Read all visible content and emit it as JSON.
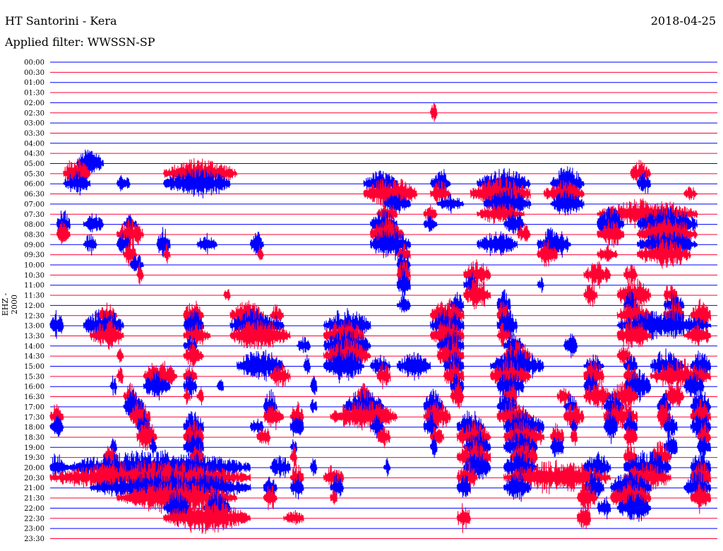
{
  "header": {
    "station": "HT Santorini - Kera",
    "date": "2018-04-25",
    "filter": "Applied filter: WWSSN-SP"
  },
  "colors": {
    "blue": "#0000ff",
    "red": "#ff0033"
  },
  "chart_data": {
    "type": "helicorder",
    "ylabel": "EHZ - 2000",
    "row_labels": [
      "00:00",
      "00:30",
      "01:00",
      "01:30",
      "02:00",
      "02:30",
      "03:00",
      "03:30",
      "04:00",
      "04:30",
      "05:00",
      "05:30",
      "06:00",
      "06:30",
      "07:00",
      "07:30",
      "08:00",
      "08:30",
      "09:00",
      "09:30",
      "10:00",
      "10:30",
      "11:00",
      "11:30",
      "12:00",
      "12:30",
      "13:00",
      "13:30",
      "14:00",
      "14:30",
      "15:00",
      "15:30",
      "16:00",
      "16:30",
      "17:00",
      "17:30",
      "18:00",
      "18:30",
      "19:00",
      "19:30",
      "20:00",
      "20:30",
      "21:00",
      "21:30",
      "22:00",
      "22:30",
      "23:00",
      "23:30"
    ],
    "row_colors": [
      "blue",
      "red",
      "blue",
      "red",
      "blue",
      "red",
      "blue",
      "red",
      "blue",
      "red",
      "blue",
      "red",
      "blue",
      "red",
      "blue",
      "red",
      "blue",
      "red",
      "blue",
      "red",
      "blue",
      "red",
      "blue",
      "red",
      "blue",
      "red",
      "blue",
      "red",
      "blue",
      "red",
      "blue",
      "red",
      "blue",
      "red",
      "blue",
      "red",
      "blue",
      "red",
      "blue",
      "red",
      "blue",
      "red",
      "blue",
      "red",
      "blue",
      "red",
      "blue",
      "red"
    ],
    "activity": [
      [],
      [],
      [],
      [],
      [],
      [
        [
          0.57,
          0.58,
          1.2
        ]
      ],
      [],
      [],
      [],
      [],
      [
        [
          0.04,
          0.08,
          1.6
        ]
      ],
      [
        [
          0.02,
          0.06,
          1.8
        ],
        [
          0.17,
          0.28,
          1.6
        ],
        [
          0.87,
          0.9,
          1.4
        ]
      ],
      [
        [
          0.02,
          0.06,
          1.4
        ],
        [
          0.1,
          0.12,
          1.0
        ],
        [
          0.17,
          0.27,
          1.6
        ],
        [
          0.47,
          0.52,
          1.4
        ],
        [
          0.57,
          0.6,
          1.8
        ],
        [
          0.64,
          0.72,
          1.6
        ],
        [
          0.75,
          0.8,
          1.8
        ],
        [
          0.88,
          0.9,
          1.4
        ]
      ],
      [
        [
          0.47,
          0.55,
          1.8
        ],
        [
          0.57,
          0.6,
          1.4
        ],
        [
          0.63,
          0.72,
          1.8
        ],
        [
          0.74,
          0.8,
          1.4
        ],
        [
          0.95,
          0.97,
          0.8
        ]
      ],
      [
        [
          0.5,
          0.54,
          1.2
        ],
        [
          0.58,
          0.62,
          1.0
        ],
        [
          0.65,
          0.72,
          1.6
        ],
        [
          0.75,
          0.8,
          1.4
        ]
      ],
      [
        [
          0.49,
          0.52,
          1.4
        ],
        [
          0.56,
          0.58,
          1.0
        ],
        [
          0.64,
          0.71,
          1.2
        ],
        [
          0.82,
          0.97,
          1.6
        ]
      ],
      [
        [
          0.01,
          0.03,
          1.6
        ],
        [
          0.05,
          0.08,
          1.2
        ],
        [
          0.11,
          0.13,
          1.0
        ],
        [
          0.48,
          0.52,
          1.4
        ],
        [
          0.56,
          0.58,
          1.0
        ],
        [
          0.68,
          0.71,
          1.4
        ],
        [
          0.82,
          0.86,
          1.8
        ],
        [
          0.88,
          0.97,
          1.8
        ]
      ],
      [
        [
          0.01,
          0.03,
          1.4
        ],
        [
          0.1,
          0.14,
          1.6
        ],
        [
          0.48,
          0.53,
          1.8
        ],
        [
          0.7,
          0.72,
          1.2
        ],
        [
          0.82,
          0.86,
          1.6
        ],
        [
          0.88,
          0.97,
          1.8
        ]
      ],
      [
        [
          0.05,
          0.07,
          1.2
        ],
        [
          0.1,
          0.12,
          1.4
        ],
        [
          0.16,
          0.18,
          1.8
        ],
        [
          0.22,
          0.25,
          1.2
        ],
        [
          0.3,
          0.32,
          1.6
        ],
        [
          0.48,
          0.54,
          1.8
        ],
        [
          0.64,
          0.7,
          1.4
        ],
        [
          0.73,
          0.78,
          1.8
        ],
        [
          0.88,
          0.97,
          1.4
        ]
      ],
      [
        [
          0.11,
          0.13,
          1.4
        ],
        [
          0.17,
          0.18,
          1.2
        ],
        [
          0.31,
          0.32,
          1.0
        ],
        [
          0.52,
          0.54,
          1.2
        ],
        [
          0.73,
          0.76,
          1.6
        ],
        [
          0.82,
          0.85,
          1.2
        ],
        [
          0.88,
          0.96,
          1.6
        ]
      ],
      [
        [
          0.12,
          0.14,
          1.2
        ],
        [
          0.52,
          0.54,
          1.6
        ]
      ],
      [
        [
          0.13,
          0.14,
          1.4
        ],
        [
          0.52,
          0.54,
          1.8
        ],
        [
          0.62,
          0.66,
          1.6
        ],
        [
          0.8,
          0.84,
          1.4
        ],
        [
          0.86,
          0.88,
          1.2
        ]
      ],
      [
        [
          0.52,
          0.54,
          1.8
        ],
        [
          0.62,
          0.64,
          1.4
        ],
        [
          0.73,
          0.74,
          1.0
        ]
      ],
      [
        [
          0.26,
          0.27,
          1.0
        ],
        [
          0.62,
          0.66,
          1.8
        ],
        [
          0.8,
          0.82,
          1.6
        ],
        [
          0.85,
          0.9,
          1.8
        ],
        [
          0.92,
          0.94,
          1.4
        ]
      ],
      [
        [
          0.52,
          0.54,
          1.0
        ],
        [
          0.6,
          0.62,
          1.4
        ],
        [
          0.67,
          0.69,
          1.8
        ],
        [
          0.86,
          0.88,
          1.6
        ],
        [
          0.92,
          0.95,
          1.4
        ]
      ],
      [
        [
          0.07,
          0.1,
          1.4
        ],
        [
          0.2,
          0.23,
          1.6
        ],
        [
          0.27,
          0.32,
          1.6
        ],
        [
          0.33,
          0.35,
          1.2
        ],
        [
          0.57,
          0.62,
          1.8
        ],
        [
          0.67,
          0.69,
          1.8
        ],
        [
          0.85,
          0.9,
          1.6
        ],
        [
          0.92,
          0.95,
          1.8
        ],
        [
          0.96,
          0.99,
          1.8
        ]
      ],
      [
        [
          0.0,
          0.02,
          1.6
        ],
        [
          0.05,
          0.11,
          1.8
        ],
        [
          0.2,
          0.23,
          1.6
        ],
        [
          0.27,
          0.35,
          1.8
        ],
        [
          0.41,
          0.48,
          1.8
        ],
        [
          0.57,
          0.62,
          1.8
        ],
        [
          0.67,
          0.7,
          1.8
        ],
        [
          0.85,
          0.99,
          1.6
        ]
      ],
      [
        [
          0.06,
          0.11,
          1.6
        ],
        [
          0.2,
          0.24,
          1.4
        ],
        [
          0.27,
          0.36,
          1.8
        ],
        [
          0.41,
          0.47,
          1.8
        ],
        [
          0.57,
          0.62,
          1.8
        ],
        [
          0.67,
          0.69,
          1.4
        ],
        [
          0.85,
          0.9,
          1.8
        ],
        [
          0.95,
          0.99,
          1.4
        ]
      ],
      [
        [
          0.2,
          0.22,
          1.2
        ],
        [
          0.37,
          0.39,
          1.0
        ],
        [
          0.41,
          0.48,
          1.8
        ],
        [
          0.58,
          0.62,
          1.8
        ],
        [
          0.68,
          0.71,
          1.4
        ],
        [
          0.77,
          0.79,
          1.4
        ]
      ],
      [
        [
          0.1,
          0.11,
          0.8
        ],
        [
          0.2,
          0.23,
          1.4
        ],
        [
          0.41,
          0.48,
          1.8
        ],
        [
          0.58,
          0.62,
          1.8
        ],
        [
          0.68,
          0.72,
          1.8
        ],
        [
          0.85,
          0.87,
          1.2
        ]
      ],
      [
        [
          0.28,
          0.35,
          1.8
        ],
        [
          0.38,
          0.39,
          1.4
        ],
        [
          0.41,
          0.47,
          1.8
        ],
        [
          0.48,
          0.51,
          1.2
        ],
        [
          0.52,
          0.57,
          1.6
        ],
        [
          0.59,
          0.62,
          1.6
        ],
        [
          0.66,
          0.74,
          1.8
        ],
        [
          0.8,
          0.83,
          1.2
        ],
        [
          0.86,
          0.88,
          1.4
        ],
        [
          0.9,
          0.95,
          1.8
        ],
        [
          0.96,
          0.99,
          1.8
        ]
      ],
      [
        [
          0.1,
          0.11,
          1.0
        ],
        [
          0.14,
          0.19,
          1.8
        ],
        [
          0.2,
          0.22,
          1.2
        ],
        [
          0.33,
          0.36,
          1.4
        ],
        [
          0.49,
          0.51,
          1.6
        ],
        [
          0.59,
          0.62,
          1.6
        ],
        [
          0.66,
          0.72,
          1.8
        ],
        [
          0.8,
          0.83,
          1.8
        ],
        [
          0.86,
          0.88,
          1.4
        ],
        [
          0.9,
          0.99,
          1.8
        ]
      ],
      [
        [
          0.09,
          0.1,
          1.2
        ],
        [
          0.14,
          0.18,
          1.6
        ],
        [
          0.2,
          0.22,
          1.4
        ],
        [
          0.25,
          0.26,
          1.0
        ],
        [
          0.39,
          0.4,
          1.4
        ],
        [
          0.6,
          0.62,
          1.8
        ],
        [
          0.67,
          0.71,
          1.8
        ],
        [
          0.8,
          0.82,
          1.6
        ],
        [
          0.86,
          0.9,
          1.8
        ],
        [
          0.95,
          0.98,
          1.6
        ]
      ],
      [
        [
          0.11,
          0.13,
          1.4
        ],
        [
          0.2,
          0.21,
          1.0
        ],
        [
          0.22,
          0.23,
          1.2
        ],
        [
          0.46,
          0.48,
          1.6
        ],
        [
          0.6,
          0.62,
          1.6
        ],
        [
          0.68,
          0.7,
          1.8
        ],
        [
          0.76,
          0.78,
          1.2
        ],
        [
          0.8,
          0.84,
          1.8
        ],
        [
          0.84,
          0.88,
          1.6
        ],
        [
          0.92,
          0.95,
          1.6
        ]
      ],
      [
        [
          0.11,
          0.14,
          1.8
        ],
        [
          0.32,
          0.34,
          1.8
        ],
        [
          0.39,
          0.4,
          1.2
        ],
        [
          0.44,
          0.5,
          1.8
        ],
        [
          0.56,
          0.59,
          1.8
        ],
        [
          0.67,
          0.7,
          1.8
        ],
        [
          0.77,
          0.79,
          1.4
        ],
        [
          0.83,
          0.86,
          1.8
        ],
        [
          0.91,
          0.93,
          1.6
        ],
        [
          0.96,
          0.99,
          1.8
        ]
      ],
      [
        [
          0.0,
          0.02,
          1.4
        ],
        [
          0.12,
          0.15,
          1.8
        ],
        [
          0.32,
          0.35,
          1.6
        ],
        [
          0.36,
          0.38,
          1.6
        ],
        [
          0.42,
          0.52,
          1.8
        ],
        [
          0.56,
          0.6,
          1.8
        ],
        [
          0.67,
          0.72,
          1.8
        ],
        [
          0.77,
          0.8,
          1.6
        ],
        [
          0.83,
          0.88,
          1.8
        ],
        [
          0.91,
          0.93,
          1.8
        ],
        [
          0.96,
          0.99,
          1.8
        ]
      ],
      [
        [
          0.0,
          0.02,
          1.2
        ],
        [
          0.13,
          0.15,
          1.8
        ],
        [
          0.2,
          0.23,
          1.8
        ],
        [
          0.3,
          0.32,
          1.2
        ],
        [
          0.36,
          0.38,
          1.8
        ],
        [
          0.48,
          0.5,
          1.4
        ],
        [
          0.56,
          0.58,
          1.6
        ],
        [
          0.61,
          0.65,
          1.8
        ],
        [
          0.68,
          0.74,
          1.8
        ],
        [
          0.78,
          0.79,
          1.4
        ],
        [
          0.83,
          0.85,
          1.8
        ],
        [
          0.86,
          0.88,
          1.6
        ],
        [
          0.92,
          0.94,
          1.6
        ],
        [
          0.96,
          0.99,
          1.8
        ]
      ],
      [
        [
          0.13,
          0.16,
          1.8
        ],
        [
          0.2,
          0.23,
          1.8
        ],
        [
          0.31,
          0.33,
          1.4
        ],
        [
          0.49,
          0.51,
          1.4
        ],
        [
          0.57,
          0.59,
          1.6
        ],
        [
          0.61,
          0.66,
          1.8
        ],
        [
          0.68,
          0.74,
          1.8
        ],
        [
          0.75,
          0.77,
          1.6
        ],
        [
          0.78,
          0.79,
          1.2
        ],
        [
          0.86,
          0.88,
          1.4
        ],
        [
          0.97,
          0.99,
          1.6
        ]
      ],
      [
        [
          0.09,
          0.1,
          1.2
        ],
        [
          0.15,
          0.16,
          1.4
        ],
        [
          0.2,
          0.23,
          1.8
        ],
        [
          0.36,
          0.37,
          1.0
        ],
        [
          0.57,
          0.58,
          1.2
        ],
        [
          0.62,
          0.66,
          1.8
        ],
        [
          0.68,
          0.73,
          1.8
        ],
        [
          0.75,
          0.77,
          1.4
        ],
        [
          0.92,
          0.94,
          1.6
        ],
        [
          0.97,
          0.99,
          1.4
        ]
      ],
      [
        [
          0.08,
          0.1,
          1.4
        ],
        [
          0.21,
          0.23,
          1.6
        ],
        [
          0.36,
          0.37,
          1.4
        ],
        [
          0.61,
          0.66,
          1.8
        ],
        [
          0.69,
          0.73,
          1.8
        ],
        [
          0.86,
          0.88,
          1.6
        ],
        [
          0.9,
          0.93,
          1.8
        ]
      ],
      [
        [
          0.0,
          0.02,
          1.6
        ],
        [
          0.02,
          0.3,
          1.8
        ],
        [
          0.33,
          0.36,
          1.4
        ],
        [
          0.39,
          0.4,
          1.2
        ],
        [
          0.5,
          0.51,
          1.0
        ],
        [
          0.62,
          0.66,
          1.8
        ],
        [
          0.68,
          0.73,
          1.8
        ],
        [
          0.8,
          0.84,
          1.6
        ],
        [
          0.86,
          0.93,
          1.8
        ],
        [
          0.96,
          0.99,
          1.8
        ]
      ],
      [
        [
          0.0,
          0.3,
          1.8
        ],
        [
          0.36,
          0.38,
          1.4
        ],
        [
          0.41,
          0.44,
          1.4
        ],
        [
          0.61,
          0.64,
          1.8
        ],
        [
          0.68,
          0.84,
          1.8
        ],
        [
          0.86,
          0.93,
          1.6
        ],
        [
          0.96,
          0.99,
          1.8
        ]
      ],
      [
        [
          0.06,
          0.3,
          1.8
        ],
        [
          0.32,
          0.34,
          1.4
        ],
        [
          0.36,
          0.38,
          1.4
        ],
        [
          0.42,
          0.44,
          1.4
        ],
        [
          0.61,
          0.63,
          1.6
        ],
        [
          0.68,
          0.72,
          1.6
        ],
        [
          0.8,
          0.83,
          1.8
        ],
        [
          0.84,
          0.9,
          1.8
        ],
        [
          0.95,
          0.99,
          1.8
        ]
      ],
      [
        [
          0.1,
          0.28,
          1.8
        ],
        [
          0.32,
          0.34,
          1.4
        ],
        [
          0.42,
          0.43,
          1.2
        ],
        [
          0.79,
          0.82,
          1.6
        ],
        [
          0.84,
          0.9,
          1.8
        ],
        [
          0.96,
          0.99,
          1.8
        ]
      ],
      [
        [
          0.17,
          0.21,
          1.8
        ],
        [
          0.23,
          0.27,
          1.8
        ],
        [
          0.82,
          0.84,
          1.4
        ],
        [
          0.85,
          0.9,
          1.6
        ]
      ],
      [
        [
          0.17,
          0.3,
          1.8
        ],
        [
          0.35,
          0.38,
          1.0
        ],
        [
          0.61,
          0.63,
          1.8
        ],
        [
          0.79,
          0.81,
          1.8
        ]
      ]
    ]
  }
}
